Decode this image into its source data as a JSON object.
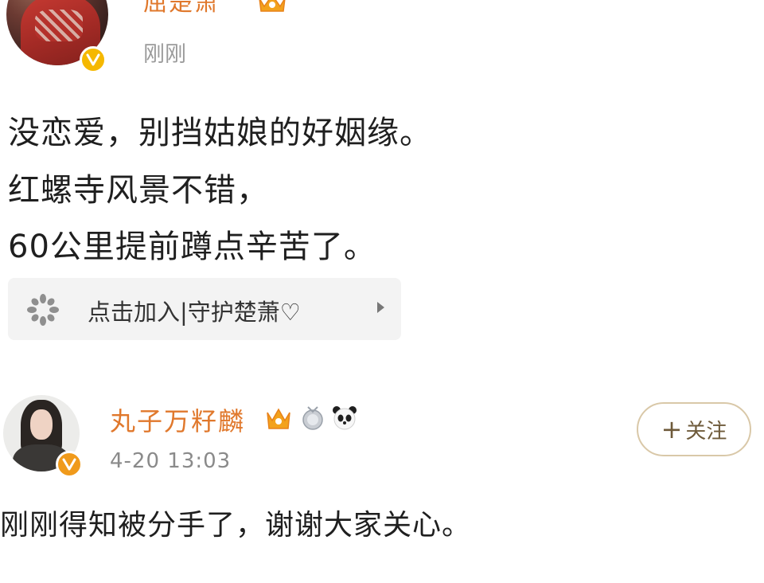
{
  "post1": {
    "author_name": "屈楚萧",
    "time": "刚刚",
    "lines": [
      "没恋爱，别挡姑娘的好姻缘。",
      "红螺寺风景不错，",
      "60公里提前蹲点辛苦了。"
    ],
    "supertopic_label": "点击加入|守护楚萧♡"
  },
  "post2": {
    "author_name": "丸子万籽麟",
    "time": "4-20 13:03",
    "follow_label": "关注",
    "follow_plus": "+",
    "content": "刚刚得知被分手了，谢谢大家关心。"
  },
  "colors": {
    "username": "#e0782c",
    "verified_badge": "#f5b800",
    "follow_border": "#d9c8a8"
  },
  "icons": {
    "verified": "verified-v-icon",
    "vip": "vip-crown-icon",
    "medal": "medal-icon",
    "panda": "panda-icon",
    "supertopic": "supertopic-flower-icon",
    "arrow": "chevron-right-icon"
  }
}
